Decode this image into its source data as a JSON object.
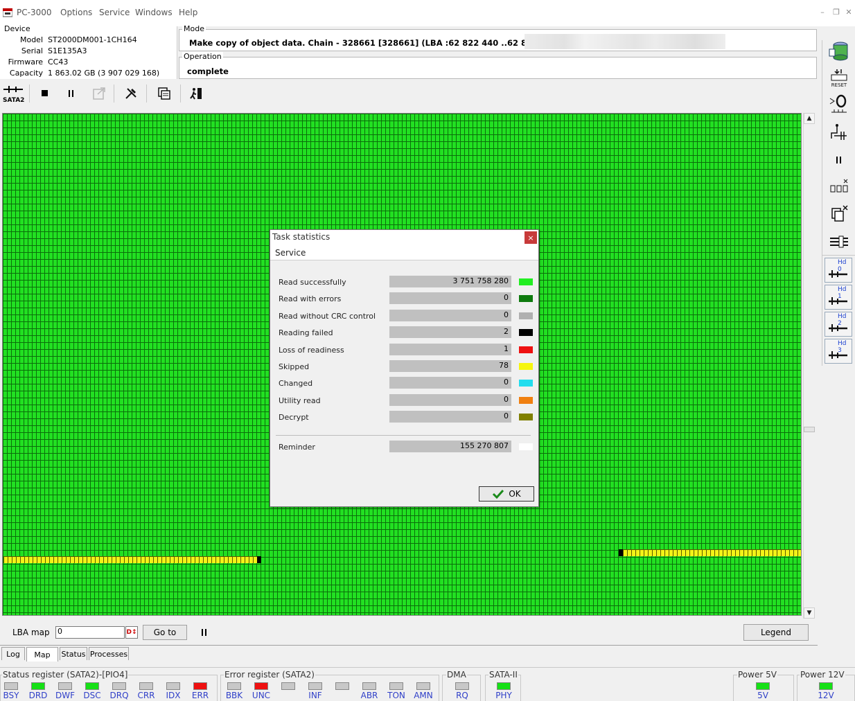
{
  "app": {
    "title": "PC-3000",
    "menu": [
      "Options",
      "Service",
      "Windows",
      "Help"
    ]
  },
  "device": {
    "group_title": "Device",
    "fields": [
      {
        "label": "Model",
        "value": "ST2000DM001-1CH164"
      },
      {
        "label": "Serial",
        "value": "S1E135A3"
      },
      {
        "label": "Firmware",
        "value": "CC43"
      },
      {
        "label": "Capacity",
        "value": "1 863.02 GB (3 907 029 168)"
      }
    ]
  },
  "mode": {
    "group_title": "Mode",
    "text": "Make copy of object data. Chain - 328661 [328661] (LBA :62 822 440 ..62 895 593) -"
  },
  "operation": {
    "group_title": "Operation",
    "text": "complete"
  },
  "toolbar": {
    "interface_label": "SATA2",
    "buttons": [
      "stop-icon",
      "pause-icon",
      "export-icon",
      "tools-icon",
      "copy-icon",
      "exit-icon"
    ]
  },
  "map": {
    "lba_label": "LBA map",
    "lba_value": "0",
    "goto_label": "Go to",
    "legend_label": "Legend"
  },
  "tabs": [
    {
      "label": "Log",
      "active": false
    },
    {
      "label": "Map",
      "active": true
    },
    {
      "label": "Status",
      "active": false
    },
    {
      "label": "Processes",
      "active": false
    }
  ],
  "registers": {
    "status": {
      "title": "Status register (SATA2)-[PIO4]",
      "leds": [
        {
          "label": "BSY",
          "color": "#c8c8c8"
        },
        {
          "label": "DRD",
          "color": "#16e016"
        },
        {
          "label": "DWF",
          "color": "#c8c8c8"
        },
        {
          "label": "DSC",
          "color": "#16e016"
        },
        {
          "label": "DRQ",
          "color": "#c8c8c8"
        },
        {
          "label": "CRR",
          "color": "#c8c8c8"
        },
        {
          "label": "IDX",
          "color": "#c8c8c8"
        },
        {
          "label": "ERR",
          "color": "#ee1010"
        }
      ]
    },
    "error": {
      "title": "Error register (SATA2)",
      "leds": [
        {
          "label": "BBK",
          "color": "#c8c8c8"
        },
        {
          "label": "UNC",
          "color": "#ee1010"
        },
        {
          "label": "",
          "color": "#c8c8c8"
        },
        {
          "label": "INF",
          "color": "#c8c8c8"
        },
        {
          "label": "",
          "color": "#c8c8c8"
        },
        {
          "label": "ABR",
          "color": "#c8c8c8"
        },
        {
          "label": "TON",
          "color": "#c8c8c8"
        },
        {
          "label": "AMN",
          "color": "#c8c8c8"
        }
      ]
    },
    "dma": {
      "title": "DMA",
      "leds": [
        {
          "label": "RQ",
          "color": "#c8c8c8"
        }
      ]
    },
    "sata": {
      "title": "SATA-II",
      "leds": [
        {
          "label": "PHY",
          "color": "#16e016"
        }
      ]
    },
    "power5": {
      "title": "Power 5V",
      "leds": [
        {
          "label": "5V",
          "color": "#16e016"
        }
      ]
    },
    "power12": {
      "title": "Power 12V",
      "leds": [
        {
          "label": "12V",
          "color": "#16e016"
        }
      ]
    }
  },
  "right_tools": {
    "hd_labels": [
      "Hd 0",
      "Hd 1",
      "Hd 2",
      "Hd 3"
    ],
    "reset_label": "RESET"
  },
  "dialog": {
    "title": "Task statistics",
    "subtitle": "Service",
    "stats": [
      {
        "label": "Read successfully",
        "value": "3 751 758 280",
        "color": "#22ee22"
      },
      {
        "label": "Read with errors",
        "value": "0",
        "color": "#0e7a0e"
      },
      {
        "label": "Read without CRC control",
        "value": "0",
        "color": "#b0b0b0"
      },
      {
        "label": "Reading failed",
        "value": "2",
        "color": "#000000"
      },
      {
        "label": "Loss of readiness",
        "value": "1",
        "color": "#ee1010"
      },
      {
        "label": "Skipped",
        "value": "78",
        "color": "#f6f60e"
      },
      {
        "label": "Changed",
        "value": "0",
        "color": "#22ddee"
      },
      {
        "label": "Utility read",
        "value": "0",
        "color": "#f08010"
      },
      {
        "label": "Decrypt",
        "value": "0",
        "color": "#808000"
      }
    ],
    "reminder": {
      "label": "Reminder",
      "value": "155 270 807",
      "color": "#ffffff"
    },
    "ok_label": "OK"
  }
}
